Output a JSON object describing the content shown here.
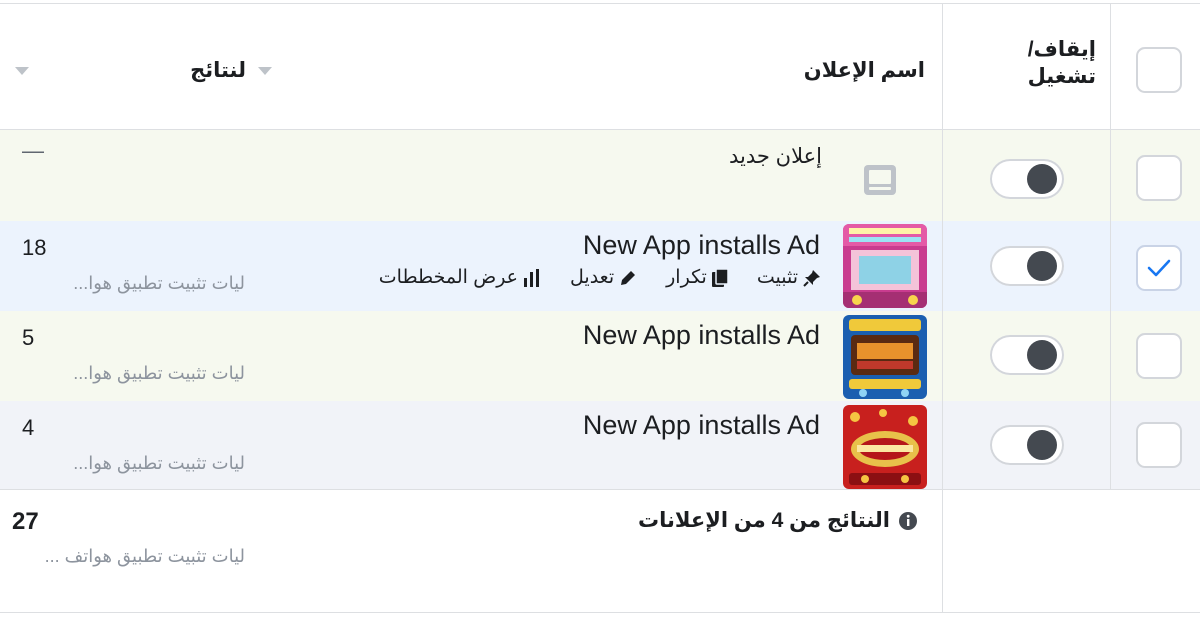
{
  "header": {
    "toggle_col": "إيقاف/ تشغيل",
    "toggle_col_line1": "إيقاف/",
    "toggle_col_line2": "تشغيل",
    "name_col": "اسم الإعلان",
    "results_col": "لنتائج"
  },
  "new_ad": {
    "label": "إعلان جديد",
    "results": "—"
  },
  "ads": [
    {
      "name": "New App installs Ad",
      "results": "18",
      "results_sub": "ليات تثبيت تطبيق هوا...",
      "selected": true,
      "actions": [
        {
          "icon": "bar-chart-icon",
          "label": "عرض المخططات"
        },
        {
          "icon": "pencil-icon",
          "label": "تعديل"
        },
        {
          "icon": "duplicate-icon",
          "label": "تكرار"
        },
        {
          "icon": "pin-icon",
          "label": "تثبيت"
        }
      ]
    },
    {
      "name": "New App installs Ad",
      "results": "5",
      "results_sub": "ليات تثبيت تطبيق هوا...",
      "selected": false
    },
    {
      "name": "New App installs Ad",
      "results": "4",
      "results_sub": "ليات تثبيت تطبيق هوا...",
      "selected": false
    }
  ],
  "footer": {
    "summary_label": "النتائج من 4 من الإعلانات",
    "total": "27",
    "total_sub": "ليات تثبيت تطبيق هواتف ..."
  },
  "colors": {
    "row_green": "#f6f9ef",
    "row_blue": "#ecf3fd",
    "check_blue": "#1877f2",
    "border": "#dddfe2"
  }
}
